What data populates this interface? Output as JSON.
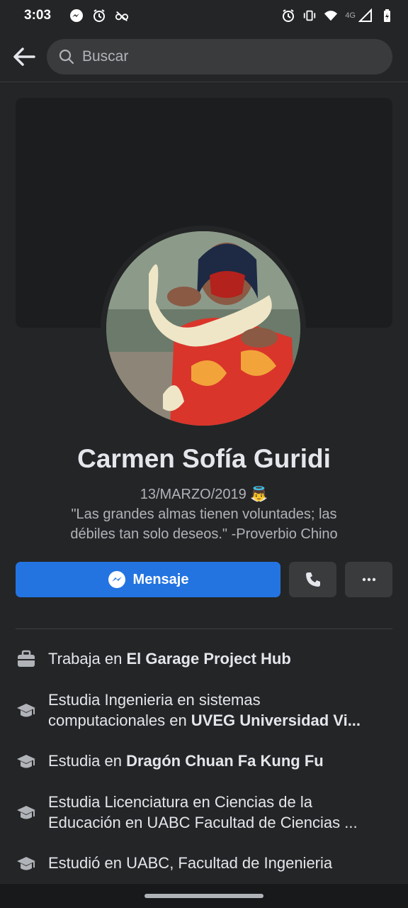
{
  "status_bar": {
    "time": "3:03",
    "network": "4G",
    "left_icons": [
      "messenger-icon",
      "alarm-icon",
      "eyeglasses-icon"
    ],
    "right_icons": [
      "alarm-icon",
      "vibrate-icon",
      "wifi-icon",
      "signal-icon",
      "battery-icon"
    ]
  },
  "search": {
    "placeholder": "Buscar"
  },
  "profile": {
    "name": "Carmen Sofía Guridi",
    "bio_date": "13/MARZO/2019",
    "bio_emoji": "👼",
    "bio_quote_line1": "\"Las grandes almas tienen voluntades; las",
    "bio_quote_line2": "débiles tan solo deseos.\" -Proverbio Chino"
  },
  "actions": {
    "message_label": "Mensaje",
    "call_icon": "phone-icon",
    "more_icon": "more-icon"
  },
  "details": [
    {
      "icon": "briefcase-icon",
      "line1_prefix": "Trabaja en ",
      "line1_bold": "El Garage Project Hub"
    },
    {
      "icon": "graduation-cap-icon",
      "line1": "Estudia Ingenieria en sistemas",
      "line2_prefix": "computacionales en ",
      "line2_bold": "UVEG Universidad Vi..."
    },
    {
      "icon": "graduation-cap-icon",
      "line1_prefix": "Estudia en ",
      "line1_bold": "Dragón Chuan Fa Kung Fu"
    },
    {
      "icon": "graduation-cap-icon",
      "line1": "Estudia Licenciatura en Ciencias de la",
      "line2": "Educación en UABC Facultad de Ciencias ..."
    },
    {
      "icon": "graduation-cap-icon",
      "line1": "Estudió en UABC, Facultad de Ingenieria"
    }
  ],
  "colors": {
    "background": "#242526",
    "accent": "#2374e1",
    "secondary_button": "#3a3b3c",
    "text_primary": "#e4e6eb",
    "text_secondary": "#b0b3b8"
  }
}
